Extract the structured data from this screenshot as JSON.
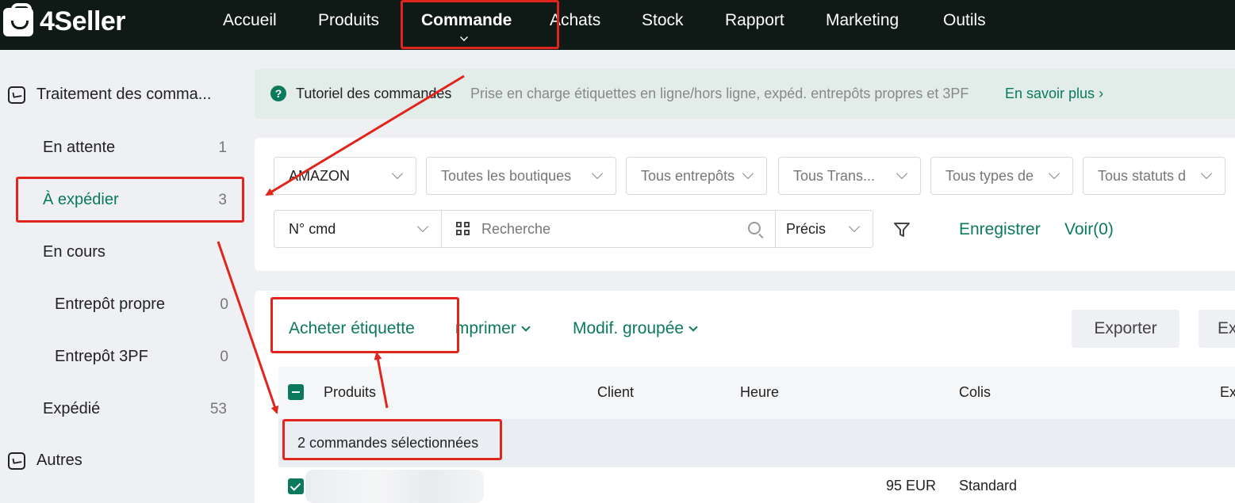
{
  "brand": {
    "name": "4Seller"
  },
  "nav": {
    "items": [
      "Accueil",
      "Produits",
      "Commande",
      "Achats",
      "Stock",
      "Rapport",
      "Marketing",
      "Outils"
    ],
    "active": "Commande"
  },
  "sidebar": {
    "section1": "Traitement des comma...",
    "items": [
      {
        "label": "En attente",
        "count": "1"
      },
      {
        "label": "À expédier",
        "count": "3"
      },
      {
        "label": "En cours",
        "count": ""
      },
      {
        "label": "Entrepôt propre",
        "count": "0"
      },
      {
        "label": "Entrepôt 3PF",
        "count": "0"
      },
      {
        "label": "Expédié",
        "count": "53"
      }
    ],
    "section2": "Autres"
  },
  "tutorial": {
    "title": "Tutoriel des commandes",
    "description": "Prise en charge étiquettes en ligne/hors ligne, expéd. entrepôts propres et 3PF",
    "link": "En savoir plus"
  },
  "filters": {
    "platform": "AMAZON",
    "shops": "Toutes les boutiques",
    "warehouses": "Tous entrepôts",
    "carriers": "Tous Trans...",
    "types": "Tous types de",
    "statuses": "Tous statuts d",
    "search_field": "N° cmd",
    "search_placeholder": "Recherche",
    "match_mode": "Précis",
    "save_label": "Enregistrer",
    "view_label": "Voir(0)"
  },
  "actions": {
    "buy_label": "Acheter étiquette",
    "print_label": "Imprimer",
    "bulk_edit_label": "Modif. groupée",
    "export_label": "Exporter",
    "more_label": "Ex"
  },
  "table": {
    "columns": [
      "Produits",
      "Client",
      "Heure",
      "Colis",
      "Ex"
    ],
    "selection_text": "2 commandes sélectionnées",
    "row1": {
      "amount": "95 EUR",
      "shipping": "Standard"
    }
  }
}
